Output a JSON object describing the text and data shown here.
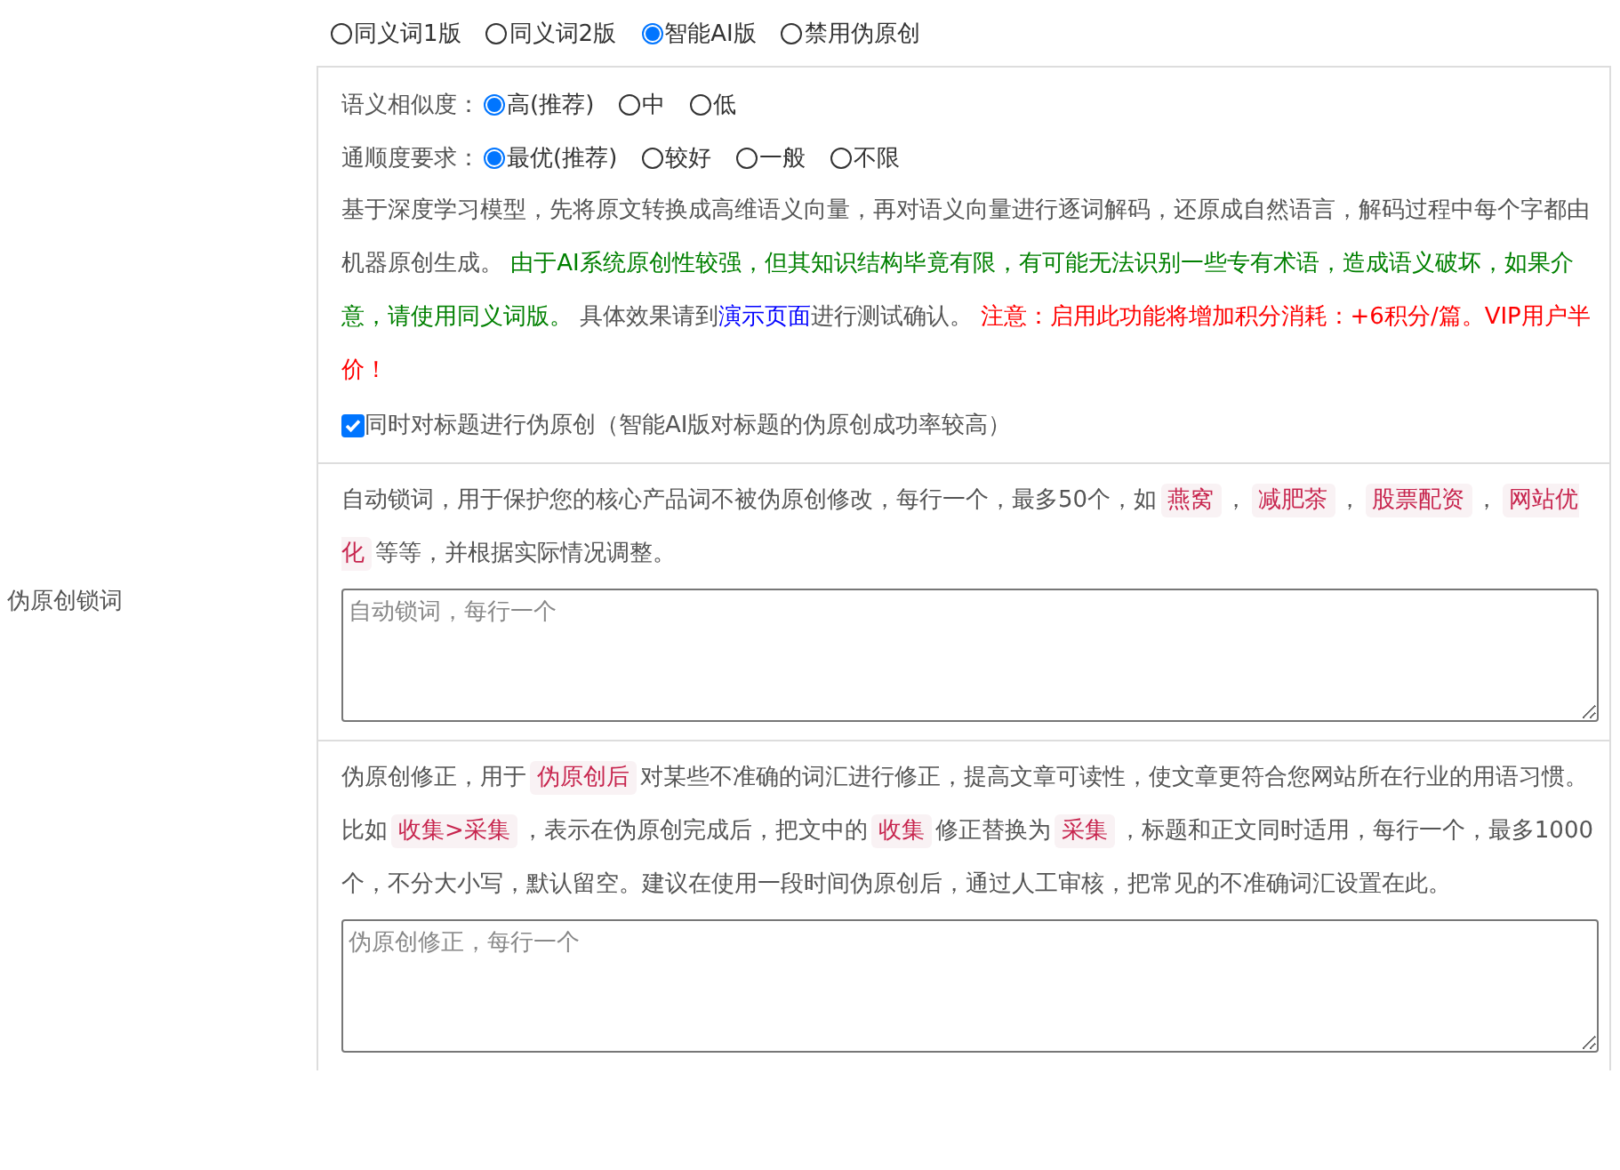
{
  "modes": [
    {
      "label": "同义词1版",
      "selected": false
    },
    {
      "label": "同义词2版",
      "selected": false
    },
    {
      "label": "智能AI版",
      "selected": true
    },
    {
      "label": "禁用伪原创",
      "selected": false
    }
  ],
  "ai_settings": {
    "similarity": {
      "label": "语义相似度：",
      "options": [
        {
          "label": "高(推荐)",
          "selected": true
        },
        {
          "label": "中",
          "selected": false
        },
        {
          "label": "低",
          "selected": false
        }
      ]
    },
    "fluency": {
      "label": "通顺度要求：",
      "options": [
        {
          "label": "最优(推荐)",
          "selected": true
        },
        {
          "label": "较好",
          "selected": false
        },
        {
          "label": "一般",
          "selected": false
        },
        {
          "label": "不限",
          "selected": false
        }
      ]
    },
    "description": [
      {
        "kind": "text",
        "text": "基于深度学习模型，先将原文转换成高维语义向量，再对语义向量进行逐词解码，还原成自然语言，解码过程中每个字都由机器原创生成。 "
      },
      {
        "kind": "warning",
        "text": "由于AI系统原创性较强，但其知识结构毕竟有限，有可能无法识别一些专有术语，造成语义破坏，如果介意，请使用同义词版。"
      },
      {
        "kind": "text",
        "text": " 具体效果请到"
      },
      {
        "kind": "link",
        "text": "演示页面"
      },
      {
        "kind": "text",
        "text": "进行测试确认。 "
      },
      {
        "kind": "alert",
        "text": "注意：启用此功能将增加积分消耗：+6积分/篇。VIP用户半价！"
      }
    ],
    "title_option": {
      "label": "同时对标题进行伪原创（智能AI版对标题的伪原创成功率较高）",
      "checked": true
    }
  },
  "lock_words": {
    "label": "伪原创锁词",
    "description": [
      {
        "kind": "text",
        "text": "自动锁词，用于保护您的核心产品词不被伪原创修改，每行一个，最多50个，如"
      },
      {
        "kind": "tag",
        "text": "燕窝"
      },
      {
        "kind": "text",
        "text": "，"
      },
      {
        "kind": "tag",
        "text": "减肥茶"
      },
      {
        "kind": "text",
        "text": "，"
      },
      {
        "kind": "tag",
        "text": "股票配资"
      },
      {
        "kind": "text",
        "text": "，"
      },
      {
        "kind": "tag",
        "text": "网站优化"
      },
      {
        "kind": "text",
        "text": "等等，并根据实际情况调整。"
      }
    ],
    "placeholder": "自动锁词，每行一个"
  },
  "correction": {
    "description": [
      {
        "kind": "text",
        "text": "伪原创修正，用于"
      },
      {
        "kind": "tag",
        "text": "伪原创后"
      },
      {
        "kind": "text",
        "text": "对某些不准确的词汇进行修正，提高文章可读性，使文章更符合您网站所在行业的用语习惯。比如"
      },
      {
        "kind": "tag",
        "text": "收集>采集"
      },
      {
        "kind": "text",
        "text": "，表示在伪原创完成后，把文中的"
      },
      {
        "kind": "tag",
        "text": "收集"
      },
      {
        "kind": "text",
        "text": "修正替换为"
      },
      {
        "kind": "tag",
        "text": "采集"
      },
      {
        "kind": "text",
        "text": "，标题和正文同时适用，每行一个，最多1000个，不分大小写，默认留空。建议在使用一段时间伪原创后，通过人工审核，把常见的不准确词汇设置在此。"
      }
    ],
    "placeholder": "伪原创修正，每行一个"
  }
}
